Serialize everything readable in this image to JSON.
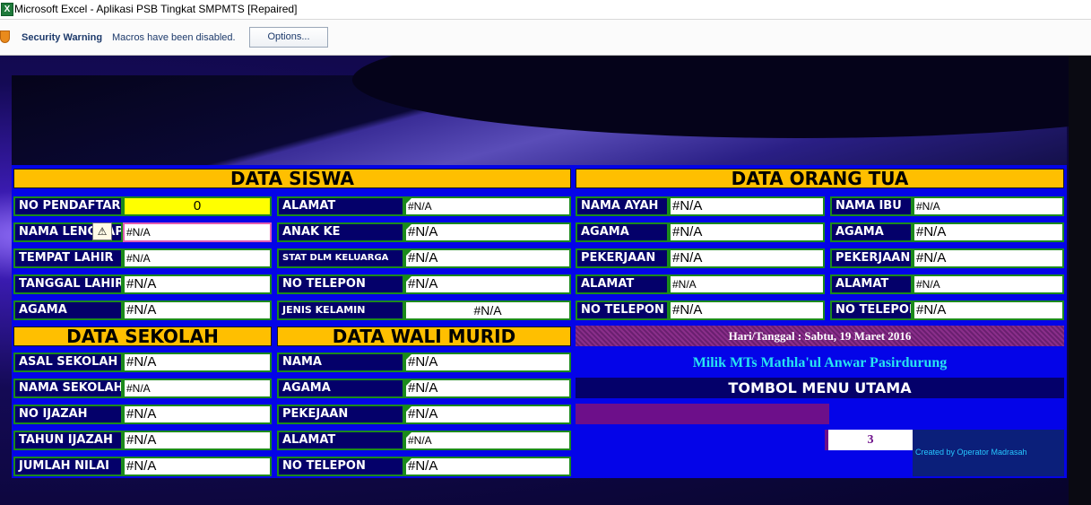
{
  "window": {
    "title": "Microsoft Excel - Aplikasi PSB Tingkat SMPMTS [Repaired]",
    "app_icon": "excel-icon"
  },
  "security_bar": {
    "icon": "shield-warning-icon",
    "title": "Security Warning",
    "message": "Macros have been disabled.",
    "options_button": "Options..."
  },
  "data_siswa": {
    "header": "DATA SISWA",
    "left": [
      {
        "label": "NO PENDAFTAR",
        "value": "0"
      },
      {
        "label": "NAMA LENGKAP",
        "value": "#N/A"
      },
      {
        "label": "TEMPAT LAHIR",
        "value": "#N/A"
      },
      {
        "label": "TANGGAL LAHIR",
        "value": "#N/A"
      },
      {
        "label": "AGAMA",
        "value": "#N/A"
      }
    ],
    "right": [
      {
        "label": "ALAMAT",
        "value": "#N/A"
      },
      {
        "label": "ANAK KE",
        "value": "#N/A"
      },
      {
        "label": "STAT DLM KELUARGA",
        "value": "#N/A"
      },
      {
        "label": "NO TELEPON",
        "value": "#N/A"
      },
      {
        "label": "JENIS KELAMIN",
        "value": "#N/A"
      }
    ]
  },
  "data_orang_tua": {
    "header": "DATA ORANG TUA",
    "ayah": [
      {
        "label": "NAMA AYAH",
        "value": "#N/A"
      },
      {
        "label": "AGAMA",
        "value": "#N/A"
      },
      {
        "label": "PEKERJAAN",
        "value": "#N/A"
      },
      {
        "label": "ALAMAT",
        "value": "#N/A"
      },
      {
        "label": "NO TELEPON",
        "value": "#N/A"
      }
    ],
    "ibu": [
      {
        "label": "NAMA IBU",
        "value": "#N/A"
      },
      {
        "label": "AGAMA",
        "value": "#N/A"
      },
      {
        "label": "PEKERJAAN",
        "value": "#N/A"
      },
      {
        "label": "ALAMAT",
        "value": "#N/A"
      },
      {
        "label": "NO TELEPON",
        "value": "#N/A"
      }
    ]
  },
  "data_sekolah": {
    "header": "DATA SEKOLAH",
    "rows": [
      {
        "label": "ASAL SEKOLAH",
        "value": "#N/A"
      },
      {
        "label": "NAMA SEKOLAH",
        "value": "#N/A"
      },
      {
        "label": "NO IJAZAH",
        "value": "#N/A"
      },
      {
        "label": "TAHUN IJAZAH",
        "value": "#N/A"
      },
      {
        "label": "JUMLAH NILAI",
        "value": "#N/A"
      }
    ]
  },
  "data_wali": {
    "header": "DATA WALI MURID",
    "rows": [
      {
        "label": "NAMA",
        "value": "#N/A"
      },
      {
        "label": "AGAMA",
        "value": "#N/A"
      },
      {
        "label": "PEKEJAAN",
        "value": "#N/A"
      },
      {
        "label": "ALAMAT",
        "value": "#N/A"
      },
      {
        "label": "NO TELEPON",
        "value": "#N/A"
      }
    ]
  },
  "info": {
    "date": "Hari/Tanggal : Sabtu, 19 Maret 2016",
    "owner": "Milik MTs Mathla'ul Anwar Pasirdurung",
    "menu_title": "TOMBOL MENU UTAMA",
    "counter": "3",
    "credit": "Created by Operator Madrasah"
  },
  "error_indicator": {
    "icon": "error-warning-icon",
    "symbol": "⚠"
  }
}
